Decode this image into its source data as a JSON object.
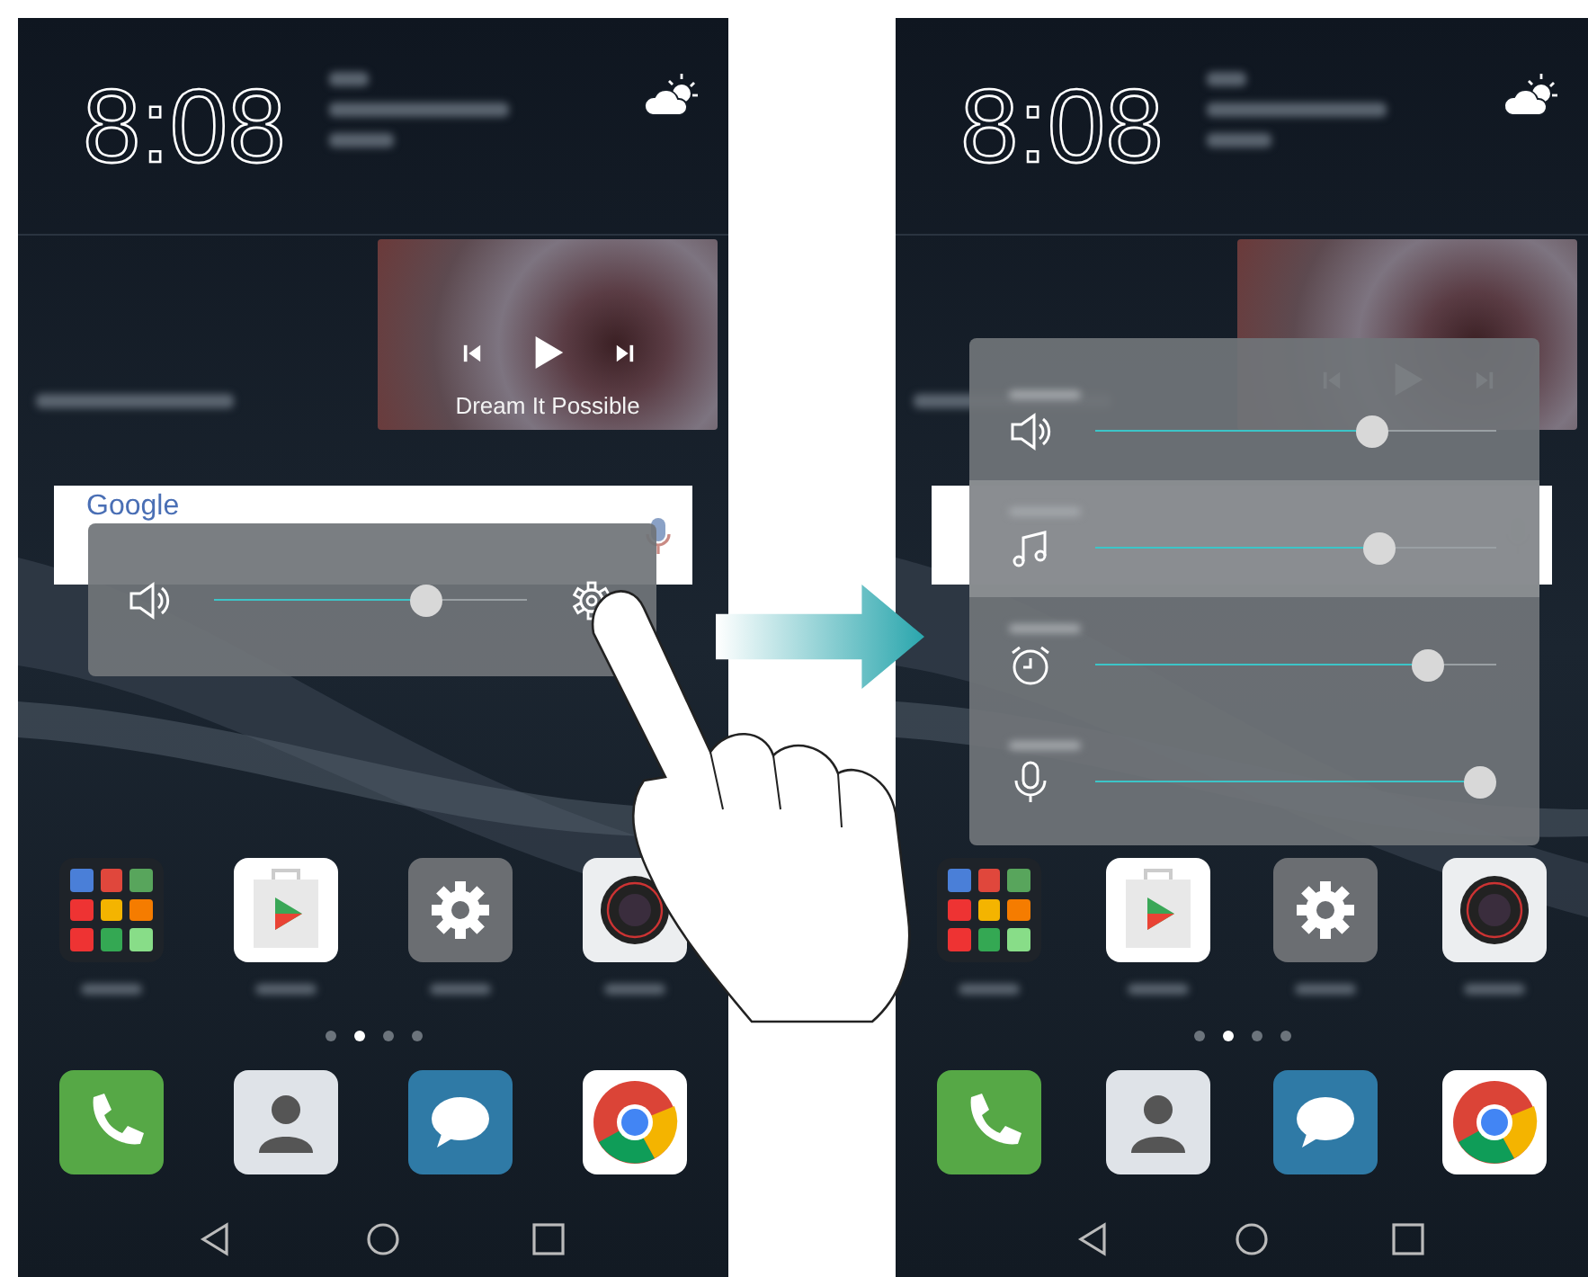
{
  "screens": [
    {
      "clock": "8:08",
      "music_title": "Dream It Possible",
      "search_logo": "Google",
      "panel": {
        "expanded": false,
        "sliders": [
          {
            "kind": "speaker",
            "level": 0.68,
            "selected": false
          }
        ]
      },
      "gesture": true,
      "apps": [
        {
          "kind": "folder"
        },
        {
          "kind": "store"
        },
        {
          "kind": "settings"
        },
        {
          "kind": "camera"
        }
      ],
      "pages": [
        {
          "selected": false
        },
        {
          "selected": true
        },
        {
          "selected": false
        },
        {
          "selected": false
        }
      ],
      "dock": [
        {
          "kind": "phone"
        },
        {
          "kind": "contacts"
        },
        {
          "kind": "messages"
        },
        {
          "kind": "browser"
        }
      ]
    },
    {
      "clock": "8:08",
      "panel": {
        "expanded": true,
        "sliders": [
          {
            "kind": "speaker",
            "level": 0.69,
            "selected": false
          },
          {
            "kind": "music",
            "level": 0.71,
            "selected": true
          },
          {
            "kind": "alarm",
            "level": 0.83,
            "selected": false
          },
          {
            "kind": "microphone",
            "level": 0.96,
            "selected": false
          }
        ]
      },
      "gesture": false,
      "apps": [
        {
          "kind": "folder"
        },
        {
          "kind": "store"
        },
        {
          "kind": "settings"
        },
        {
          "kind": "camera"
        }
      ],
      "pages": [
        {
          "selected": false
        },
        {
          "selected": true
        },
        {
          "selected": false
        },
        {
          "selected": false
        }
      ],
      "dock": [
        {
          "kind": "phone"
        },
        {
          "kind": "contacts"
        },
        {
          "kind": "messages"
        },
        {
          "kind": "browser"
        }
      ]
    }
  ]
}
